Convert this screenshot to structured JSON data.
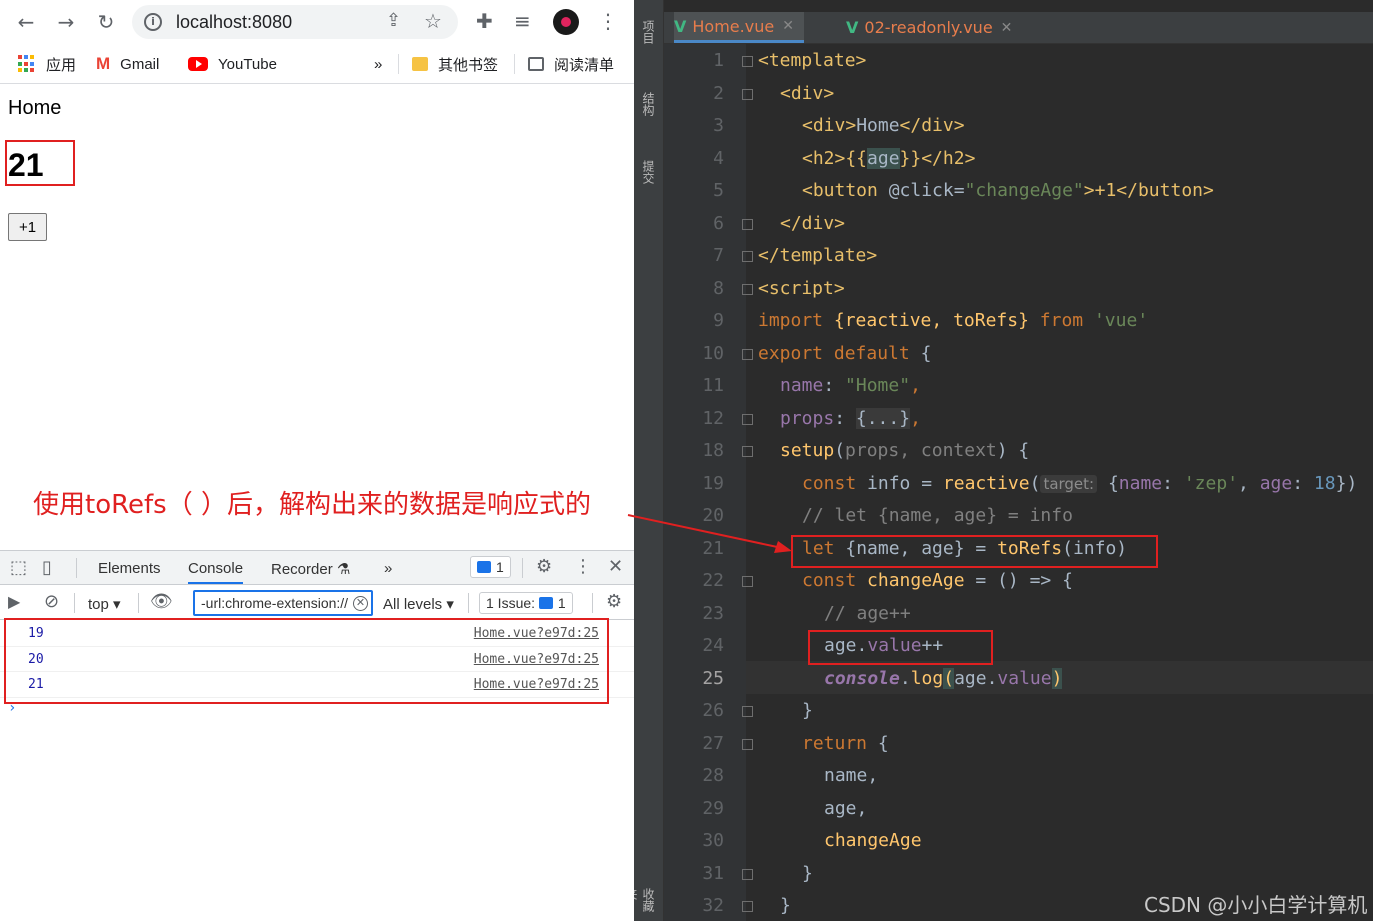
{
  "browser": {
    "url": "localhost:8080",
    "bookmarks": {
      "apps": "应用",
      "gmail": "Gmail",
      "youtube": "YouTube",
      "more": "»",
      "other": "其他书签",
      "reading_list": "阅读清单"
    },
    "page": {
      "div_text": "Home",
      "h2_age": "21",
      "button_label": "+1"
    }
  },
  "annotation": "使用toRefs（ ）后，解构出来的数据是响应式的",
  "devtools": {
    "tabs": [
      "Elements",
      "Console",
      "Recorder",
      "»"
    ],
    "active_tab": "Console",
    "message_count": "1",
    "context": "top",
    "filter_value": "-url:chrome-extension://",
    "levels": "All levels",
    "issues": "1 Issue:",
    "issues_count": "1",
    "logs": [
      {
        "value": "19",
        "source": "Home.vue?e97d:25"
      },
      {
        "value": "20",
        "source": "Home.vue?e97d:25"
      },
      {
        "value": "21",
        "source": "Home.vue?e97d:25"
      }
    ],
    "prompt": "›"
  },
  "ide": {
    "side_labels": [
      "项目",
      "结构",
      "提交",
      "收藏夹"
    ],
    "tabs": [
      {
        "name": "Home.vue",
        "active": true
      },
      {
        "name": "02-readonly.vue",
        "active": false
      }
    ],
    "line_numbers": [
      "1",
      "2",
      "3",
      "4",
      "5",
      "6",
      "7",
      "8",
      "9",
      "10",
      "11",
      "12",
      "18",
      "19",
      "20",
      "21",
      "22",
      "23",
      "24",
      "25",
      "26",
      "27",
      "28",
      "29",
      "30",
      "31",
      "32"
    ],
    "current_line": "25",
    "code": {
      "l1": "<template>",
      "l2": "<div>",
      "l3_open": "<div>",
      "l3_text": "Home",
      "l3_close": "</div>",
      "l4_open": "<h2>{{",
      "l4_var": "age",
      "l4_close": "}}</h2>",
      "l5_open": "<button ",
      "l5_attr": "@click=",
      "l5_val": "\"changeAge\"",
      "l5_close": ">+1</button>",
      "l6": "</div>",
      "l7": "</template>",
      "l8": "<script>",
      "l9_import": "import ",
      "l9_names": "{reactive, toRefs}",
      "l9_from": " from ",
      "l9_mod": "'vue'",
      "l10_a": "export default ",
      "l10_b": "{",
      "l11_key": "name",
      "l11_colon": ": ",
      "l11_val": "\"Home\"",
      "l11_comma": ",",
      "l12_key": "props",
      "l12_colon": ": ",
      "l12_fold": "{...}",
      "l12_comma": ",",
      "l18_fn": "setup",
      "l18_args_open": "(",
      "l18_params": "props, context",
      "l18_rest": ") {",
      "l19_const": "const ",
      "l19_name": "info = ",
      "l19_fn": "reactive",
      "l19_paren": "(",
      "l19_hint": "target:",
      "l19_obj_a": " {",
      "l19_k1": "name",
      "l19_c1": ": ",
      "l19_v1": "'zep'",
      "l19_c2": ", ",
      "l19_k2": "age",
      "l19_c3": ": ",
      "l19_v2": "18",
      "l19_end": "})",
      "l20": "// let {name, age} = info",
      "l21_let": "let ",
      "l21_rest": "{name, age} = ",
      "l21_fn": "toRefs",
      "l21_args": "(info)",
      "l22_const": "const ",
      "l22_fn": "changeAge",
      "l22_rest": " = () => {",
      "l23": "// age++",
      "l24_a": "age.",
      "l24_b": "value",
      "l24_c": "++",
      "l25_a": "console",
      "l25_b": ".",
      "l25_c": "log",
      "l25_d": "(",
      "l25_e": "age.",
      "l25_f": "value",
      "l25_g": ")",
      "l26": "}",
      "l27_kw": "return ",
      "l27_b": "{",
      "l28": "name,",
      "l29": "age,",
      "l30": "changeAge",
      "l31": "}",
      "l32": "}"
    },
    "watermark": "CSDN @小小白学计算机"
  },
  "colors": {
    "highlight_red": "#e02020",
    "vue_green": "#41b883",
    "devtools_blue": "#1a73e8"
  }
}
